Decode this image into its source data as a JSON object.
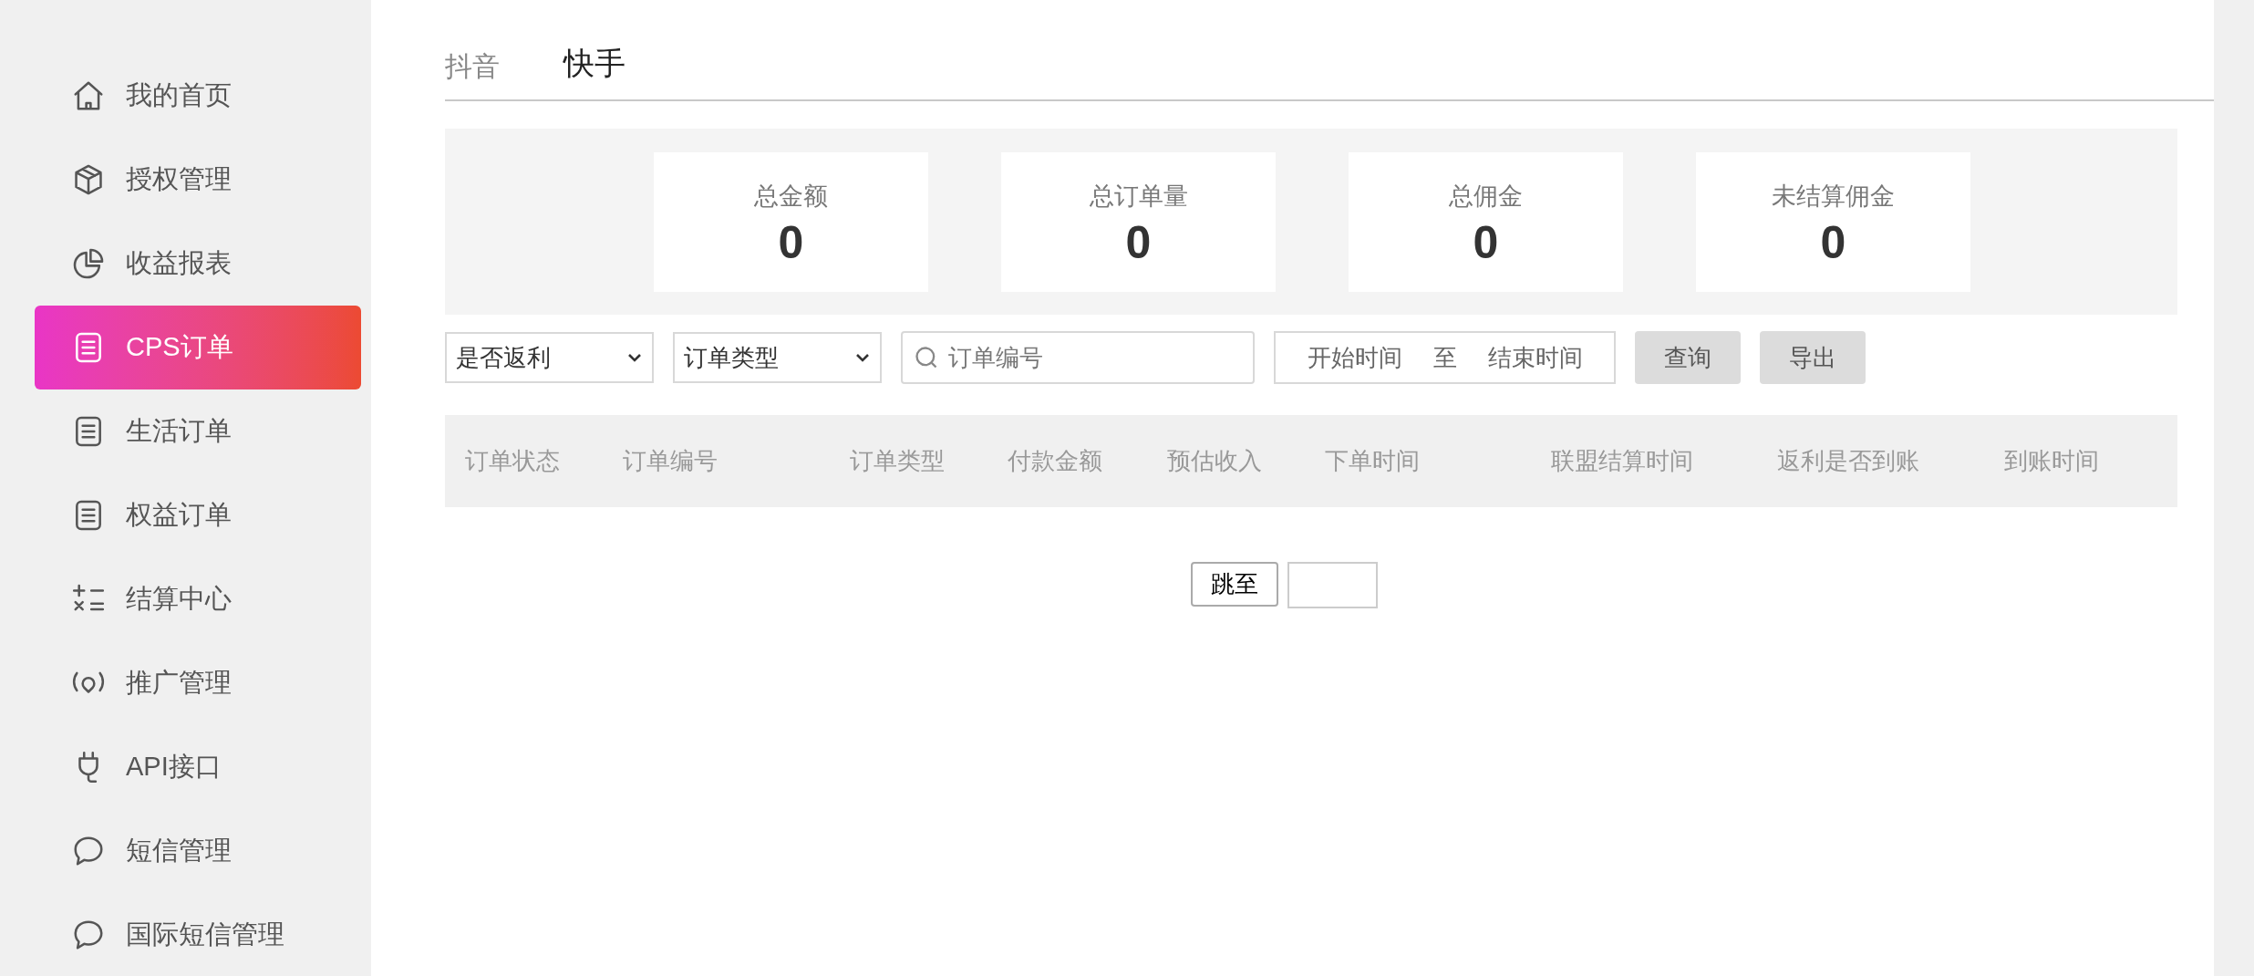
{
  "sidebar": {
    "items": [
      {
        "label": "我的首页",
        "selected": false
      },
      {
        "label": "授权管理",
        "selected": false
      },
      {
        "label": "收益报表",
        "selected": false
      },
      {
        "label": "CPS订单",
        "selected": true
      },
      {
        "label": "生活订单",
        "selected": false
      },
      {
        "label": "权益订单",
        "selected": false
      },
      {
        "label": "结算中心",
        "selected": false
      },
      {
        "label": "推广管理",
        "selected": false
      },
      {
        "label": "API接口",
        "selected": false
      },
      {
        "label": "短信管理",
        "selected": false
      },
      {
        "label": "国际短信管理",
        "selected": false
      }
    ]
  },
  "tabs": [
    {
      "label": "抖音",
      "selected": false
    },
    {
      "label": "快手",
      "selected": true
    }
  ],
  "stats": [
    {
      "label": "总金额",
      "value": "0"
    },
    {
      "label": "总订单量",
      "value": "0"
    },
    {
      "label": "总佣金",
      "value": "0"
    },
    {
      "label": "未结算佣金",
      "value": "0"
    }
  ],
  "filters": {
    "selects": [
      "是否返利",
      "订单类型"
    ],
    "search": {
      "placeholder": "订单编号"
    },
    "date_range": {
      "start_placeholder": "开始时间",
      "separator": "至",
      "end_placeholder": "结束时间"
    },
    "buttons": [
      "查询",
      "导出"
    ]
  },
  "table": {
    "columns": [
      "订单状态",
      "订单编号",
      "订单类型",
      "付款金额",
      "预估收入",
      "下单时间",
      "联盟结算时间",
      "返利是否到账",
      "到账时间"
    ]
  },
  "pagination": {
    "jump_button": "跳至"
  }
}
